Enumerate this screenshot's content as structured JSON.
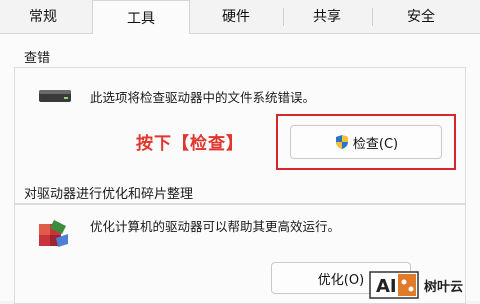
{
  "tabs": [
    {
      "label": "常规"
    },
    {
      "label": "工具"
    },
    {
      "label": "硬件"
    },
    {
      "label": "共享"
    },
    {
      "label": "安全"
    }
  ],
  "active_tab": "工具",
  "check_section": {
    "title": "查错",
    "description": "此选项将检查驱动器中的文件系统错误。",
    "annotation": "按下【检查】",
    "button_label": "检查(C)",
    "button_icon": "shield-icon"
  },
  "optimize_section": {
    "title": "对驱动器进行优化和碎片整理",
    "description": "优化计算机的驱动器可以帮助其更高效运行。",
    "button_label": "优化(O)",
    "icon": "defrag-icon"
  },
  "watermark": {
    "logo_text": "AI",
    "site_text": "树叶云"
  },
  "colors": {
    "annotation": "#e0362d",
    "highlight_border": "#d8242b",
    "shield_blue": "#2b74c9",
    "shield_yellow": "#f2c230"
  }
}
